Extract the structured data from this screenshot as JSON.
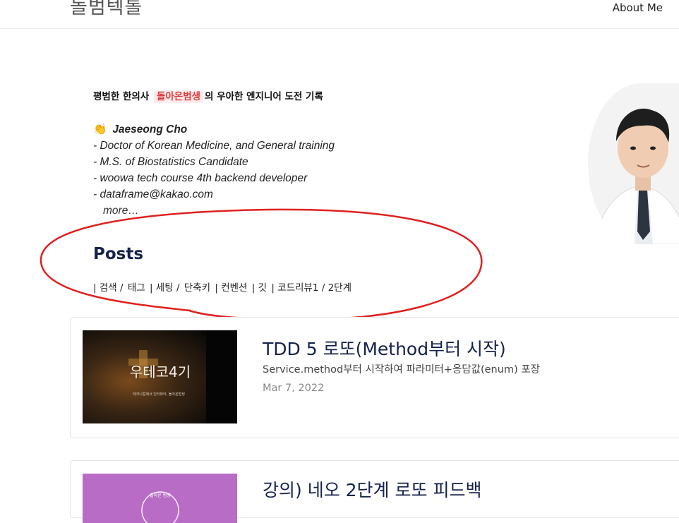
{
  "header": {
    "brand": "돌범텍톨",
    "nav_about": "About Me"
  },
  "profile": {
    "tagline_prefix": "평범한 한의사",
    "tagline_highlight": "돌아온범생",
    "tagline_suffix": "의 우아한 엔지니어 도전 기록",
    "wave_icon": "👏",
    "name": "Jaeseong Cho",
    "lines": [
      "- Doctor of Korean Medicine, and General training",
      "- M.S. of Biostatistics Candidate",
      "- woowa tech course 4th backend developer",
      "- dataframe@kakao.com"
    ],
    "more": "more…"
  },
  "posts_section": {
    "heading": "Posts",
    "categories": [
      "| 검색 /",
      "태그",
      "| 세팅 /",
      "단축키",
      "| 컨벤션",
      "| 깃",
      "| 코드리뷰1 / 2단계"
    ]
  },
  "posts": [
    {
      "title": "TDD 5 로또(Method부터 시작)",
      "description": "Service.method부터 시작하여 파라미터+응답값(enum) 포장",
      "date": "Mar 7, 2022",
      "thumb_title": "우테코4기",
      "thumb_caption": "테크니컬에서 인터뷰어, 돌아온범생",
      "thumb_color": "#2a2018"
    },
    {
      "title": "강의) 네오 2단계 로또 피드백",
      "thumb_label": "돌아온 범생",
      "thumb_color": "#b86cc6"
    }
  ],
  "annotation": {
    "color": "#e02020"
  }
}
